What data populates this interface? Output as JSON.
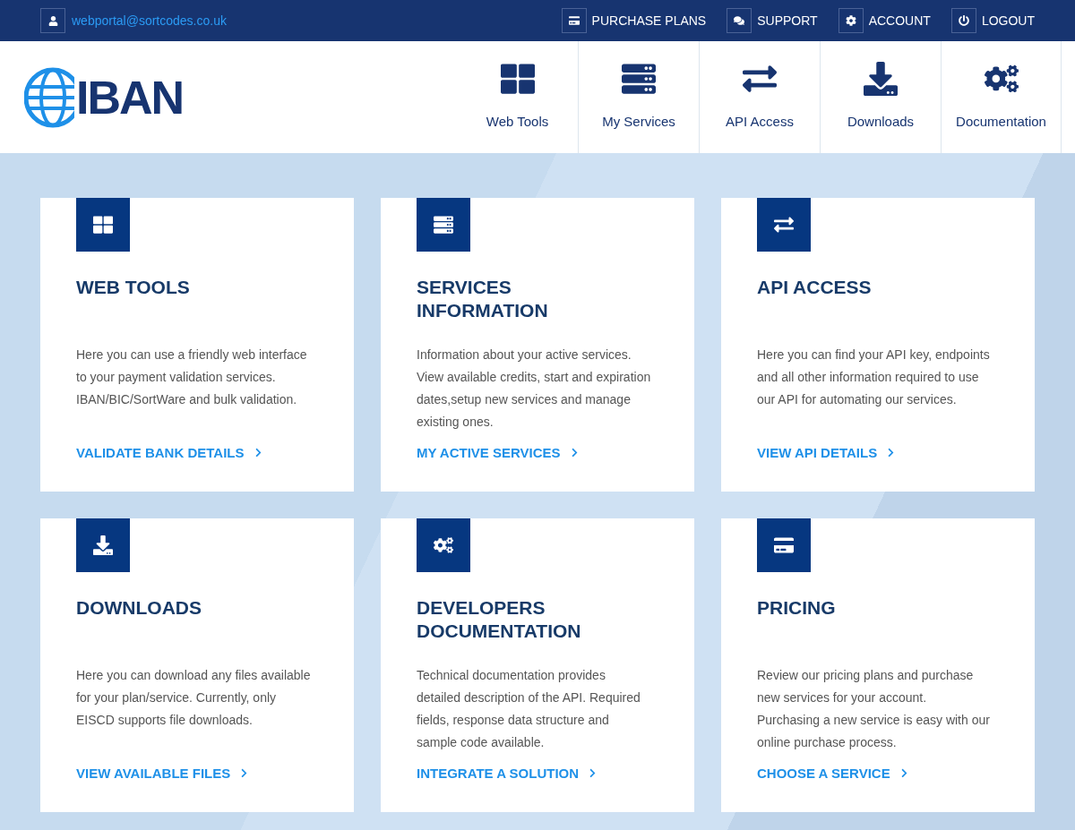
{
  "top_bar": {
    "user_email": "webportal@sortcodes.co.uk",
    "links": [
      {
        "label": "PURCHASE PLANS"
      },
      {
        "label": "SUPPORT"
      },
      {
        "label": "ACCOUNT"
      },
      {
        "label": "LOGOUT"
      }
    ]
  },
  "header": {
    "logo_text": "IBAN",
    "nav": [
      {
        "label": "Web Tools"
      },
      {
        "label": "My Services"
      },
      {
        "label": "API Access"
      },
      {
        "label": "Downloads"
      },
      {
        "label": "Documentation"
      }
    ]
  },
  "cards": [
    {
      "title": "WEB TOOLS",
      "description": "Here you can use a friendly web interface to your payment validation services. IBAN/BIC/SortWare and bulk validation.",
      "link": "VALIDATE BANK DETAILS"
    },
    {
      "title": "SERVICES INFORMATION",
      "description": "Information about your active services. View available credits, start and expiration dates,setup new services and manage existing ones.",
      "link": "MY ACTIVE SERVICES"
    },
    {
      "title": "API ACCESS",
      "description": "Here you can find your API key, endpoints and all other information required to use our API for automating our services.",
      "link": "VIEW API DETAILS"
    },
    {
      "title": "DOWNLOADS",
      "description": "Here you can download any files available for your plan/service. Currently, only EISCD supports file downloads.",
      "link": "VIEW AVAILABLE FILES"
    },
    {
      "title": "DEVELOPERS DOCUMENTATION",
      "description": "Technical documentation provides detailed description of the API. Required fields, response data structure and sample code available.",
      "link": "INTEGRATE A SOLUTION"
    },
    {
      "title": "PRICING",
      "description": "Review our pricing plans and purchase new services for your account. Purchasing a new service is easy with our online purchase process.",
      "link": "CHOOSE A SERVICE"
    }
  ]
}
